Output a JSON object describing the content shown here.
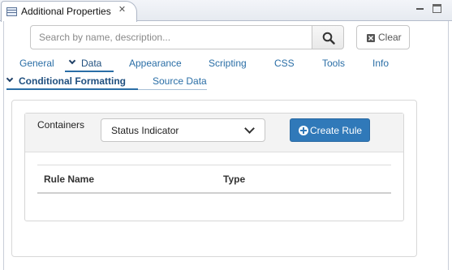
{
  "view": {
    "title": "Additional Properties",
    "icons": {
      "view": "properties-view-icon",
      "close": "close-icon",
      "minimize": "minimize-icon",
      "maximize": "maximize-icon"
    }
  },
  "search": {
    "placeholder": "Search by name, description...",
    "value": "",
    "clear_label": "Clear"
  },
  "tabs": [
    {
      "label": "General"
    },
    {
      "label": "Data"
    },
    {
      "label": "Appearance"
    },
    {
      "label": "Scripting"
    },
    {
      "label": "CSS"
    },
    {
      "label": "Tools"
    },
    {
      "label": "Info"
    }
  ],
  "active_tab": "Data",
  "subtabs": [
    {
      "label": "Conditional Formatting"
    },
    {
      "label": "Source Data"
    }
  ],
  "active_subtab": "Conditional Formatting",
  "conditional_formatting": {
    "containers_label": "Containers",
    "containers_selected": "Status Indicator",
    "create_rule_label": "Create Rule",
    "columns": [
      "Rule Name",
      "Type"
    ],
    "rows": []
  },
  "colors": {
    "accent": "#3079b9",
    "link": "#2a6ea6"
  }
}
